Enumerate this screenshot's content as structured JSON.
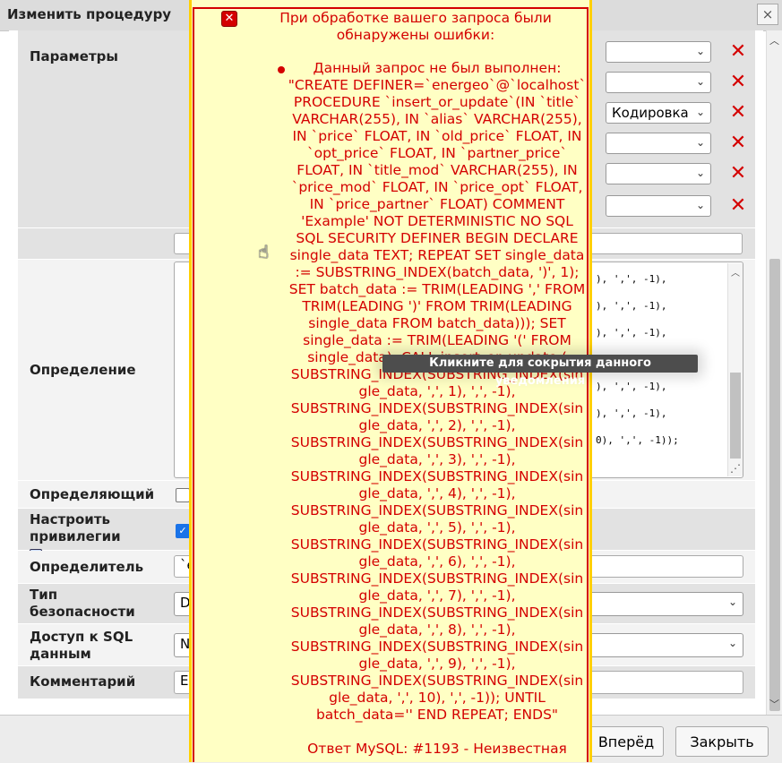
{
  "dialog": {
    "title": "Изменить процедуру",
    "close_glyph": "×"
  },
  "params": {
    "label": "Параметры",
    "charset_selected": "Кодировка"
  },
  "labels": {
    "definition": "Определение",
    "deterministic": "Определяющий",
    "privileges": "Настроить привилегии",
    "definer": "Определитель",
    "security": "Тип безопасности",
    "sql_access": "Доступ к SQL данным",
    "comment": "Комментарий"
  },
  "values": {
    "definer_prefix": "`e",
    "security_prefix": "D",
    "sql_access_prefix": "N",
    "comment_prefix": "Ex"
  },
  "code_lines": [
    "), ',', -1),",
    "), ',', -1),",
    "), ',', -1),",
    "), ',', -1),",
    "), ',', -1),",
    "0), ',', -1));"
  ],
  "buttons": {
    "forward": "Вперёд",
    "close": "Закрыть"
  },
  "tooltip": "Кликните для сокрытия данного уведомления",
  "error": {
    "header": "При обработке вашего запроса были обнаружены ошибки:",
    "message": "Данный запрос не был выполнен: \"CREATE DEFINER=`energeo`@`localhost` PROCEDURE `insert_or_update`(IN `title` VARCHAR(255), IN `alias` VARCHAR(255), IN `price` FLOAT, IN `old_price` FLOAT, IN `opt_price` FLOAT, IN `partner_price` FLOAT, IN `title_mod` VARCHAR(255), IN `price_mod` FLOAT, IN `price_opt` FLOAT, IN `price_partner` FLOAT) COMMENT 'Example' NOT DETERMINISTIC NO SQL SQL SECURITY DEFINER BEGIN DECLARE single_data TEXT; REPEAT SET single_data := SUBSTRING_INDEX(batch_data, ')', 1); SET batch_data := TRIM(LEADING ',' FROM TRIM(LEADING ')' FROM TRIM(LEADING single_data FROM batch_data))); SET single_data := TRIM(LEADING '(' FROM single_data); CALL insert_or_update ( SUBSTRING_INDEX(SUBSTRING_INDEX(single_data, ',', 1), ',', -1), SUBSTRING_INDEX(SUBSTRING_INDEX(single_data, ',', 2), ',', -1), SUBSTRING_INDEX(SUBSTRING_INDEX(single_data, ',', 3), ',', -1), SUBSTRING_INDEX(SUBSTRING_INDEX(single_data, ',', 4), ',', -1), SUBSTRING_INDEX(SUBSTRING_INDEX(single_data, ',', 5), ',', -1), SUBSTRING_INDEX(SUBSTRING_INDEX(single_data, ',', 6), ',', -1), SUBSTRING_INDEX(SUBSTRING_INDEX(single_data, ',', 7), ',', -1), SUBSTRING_INDEX(SUBSTRING_INDEX(single_data, ',', 8), ',', -1), SUBSTRING_INDEX(SUBSTRING_INDEX(single_data, ',', 9), ',', -1), SUBSTRING_INDEX(SUBSTRING_INDEX(single_data, ',', 10), ',', -1)); UNTIL batch_data='' END REPEAT; ENDS\"",
    "footer": "Ответ MySQL: #1193 - Неизвестная"
  }
}
